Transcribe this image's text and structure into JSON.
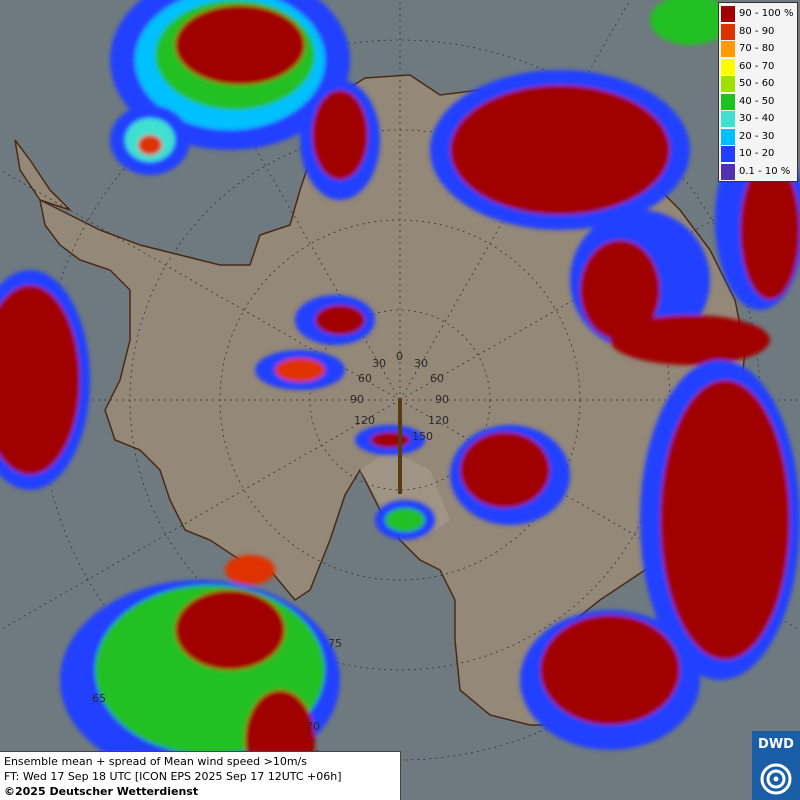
{
  "map": {
    "title_line1": "Ensemble mean + spread of Mean wind speed >10m/s",
    "title_line2": "FT: Wed 17 Sep 18 UTC [ICON EPS 2025 Sep 17 12UTC +06h]",
    "copyright": "©2025 Deutscher Wetterdienst",
    "logo_text": "DWD",
    "latitude_labels": [
      "65",
      "70",
      "75"
    ],
    "longitude_labels": {
      "top": "0",
      "upper_left": "30",
      "upper_right": "30",
      "mid_left": "60",
      "mid_right": "60",
      "left": "90",
      "right": "90",
      "lower_left": "120",
      "lower_right": "120",
      "bottom_right": "150"
    },
    "colors": {
      "ocean": "#6f7a80",
      "land": "#948878",
      "coast": "#4a2a14"
    }
  },
  "legend": {
    "items": [
      {
        "label": "90 - 100 %",
        "color": "#a00000"
      },
      {
        "label": "80 - 90",
        "color": "#e03000"
      },
      {
        "label": "70 - 80",
        "color": "#ff9a00"
      },
      {
        "label": "60 - 70",
        "color": "#ffff00"
      },
      {
        "label": "50 - 60",
        "color": "#a0e000"
      },
      {
        "label": "40 - 50",
        "color": "#20c020"
      },
      {
        "label": "30 - 40",
        "color": "#40e0d0"
      },
      {
        "label": "20 - 30",
        "color": "#00c0ff"
      },
      {
        "label": "10 - 20",
        "color": "#2040ff"
      },
      {
        "label": "0.1 - 10 %",
        "color": "#5030b0"
      }
    ]
  }
}
